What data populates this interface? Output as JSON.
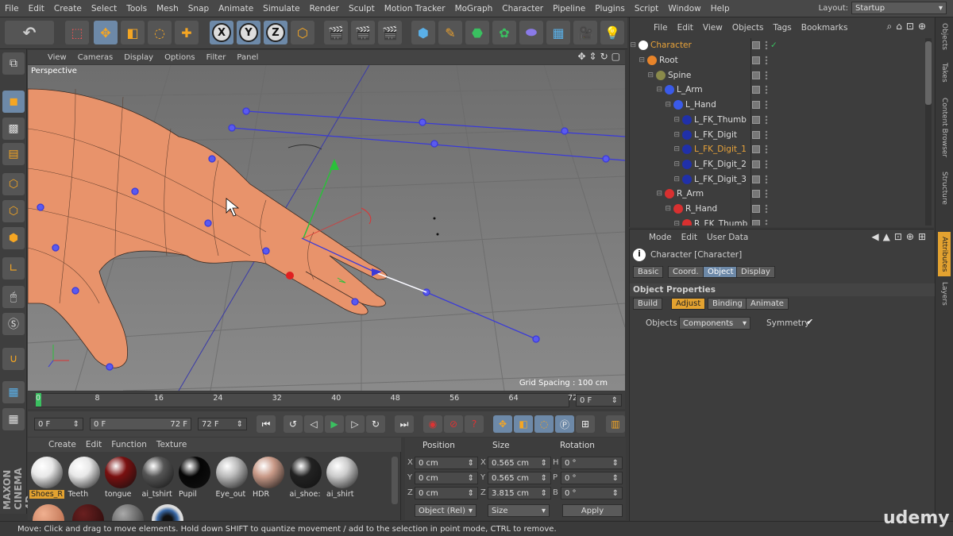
{
  "menubar": {
    "items": [
      "File",
      "Edit",
      "Create",
      "Select",
      "Tools",
      "Mesh",
      "Snap",
      "Animate",
      "Simulate",
      "Render",
      "Sculpt",
      "Motion Tracker",
      "MoGraph",
      "Character",
      "Pipeline",
      "Plugins",
      "Script",
      "Window",
      "Help"
    ],
    "layout_label": "Layout:",
    "layout_value": "Startup"
  },
  "toolbar": {
    "axis_x": "X",
    "axis_y": "Y",
    "axis_z": "Z"
  },
  "viewport": {
    "menu": [
      "View",
      "Cameras",
      "Display",
      "Options",
      "Filter",
      "Panel"
    ],
    "label": "Perspective",
    "grid_spacing": "Grid Spacing : 100 cm"
  },
  "timeline": {
    "ticks": [
      "0",
      "8",
      "16",
      "24",
      "32",
      "40",
      "48",
      "56",
      "64",
      "72"
    ],
    "end_field": "0 F"
  },
  "playback": {
    "start": "0 F",
    "range_start": "0 F",
    "range_end": "72 F",
    "end": "72 F"
  },
  "materials": {
    "menu": [
      "Create",
      "Edit",
      "Function",
      "Texture"
    ],
    "items": [
      {
        "name": "Shoes_R",
        "selected": true,
        "color": "#e8e8e8"
      },
      {
        "name": "Teeth",
        "selected": false,
        "color": "#e8e8e8"
      },
      {
        "name": "tongue",
        "selected": false,
        "color": "#7a1010"
      },
      {
        "name": "ai_tshirt",
        "selected": false,
        "color": "#555555"
      },
      {
        "name": "Pupil",
        "selected": false,
        "color": "#050505"
      },
      {
        "name": "Eye_out",
        "selected": false,
        "color": "#bbbbbb"
      },
      {
        "name": "HDR",
        "selected": false,
        "color": "#c99a88"
      },
      {
        "name": "ai_shoe:",
        "selected": false,
        "color": "#222222"
      },
      {
        "name": "ai_shirt",
        "selected": false,
        "color": "#cccccc"
      }
    ]
  },
  "coords": {
    "position_label": "Position",
    "size_label": "Size",
    "rotation_label": "Rotation",
    "rows": [
      {
        "axis": "X",
        "pos": "0 cm",
        "saxis": "X",
        "size": "0.565 cm",
        "raxis": "H",
        "rot": "0 °"
      },
      {
        "axis": "Y",
        "pos": "0 cm",
        "saxis": "Y",
        "size": "0.565 cm",
        "raxis": "P",
        "rot": "0 °"
      },
      {
        "axis": "Z",
        "pos": "0 cm",
        "saxis": "Z",
        "size": "3.815 cm",
        "raxis": "B",
        "rot": "0 °"
      }
    ],
    "mode_value": "Object (Rel)",
    "size_mode": "Size",
    "apply_label": "Apply"
  },
  "status": "Move: Click and drag to move elements. Hold down SHIFT to quantize movement / add to the selection in point mode, CTRL to remove.",
  "objects": {
    "menu": [
      "File",
      "Edit",
      "View",
      "Objects",
      "Tags",
      "Bookmarks"
    ],
    "tree": [
      {
        "name": "Character",
        "depth": 0,
        "selected": true,
        "icon_color": "#ffffff"
      },
      {
        "name": "Root",
        "depth": 1,
        "selected": false,
        "icon_color": "#e8842a"
      },
      {
        "name": "Spine",
        "depth": 2,
        "selected": false,
        "icon_color": "#8a8a4a"
      },
      {
        "name": "L_Arm",
        "depth": 3,
        "selected": false,
        "icon_color": "#3a5ae8"
      },
      {
        "name": "L_Hand",
        "depth": 4,
        "selected": false,
        "icon_color": "#3a5ae8"
      },
      {
        "name": "L_FK_Thumb",
        "depth": 5,
        "selected": false,
        "icon_color": "#2030a8"
      },
      {
        "name": "L_FK_Digit",
        "depth": 5,
        "selected": false,
        "icon_color": "#2030a8"
      },
      {
        "name": "L_FK_Digit_1",
        "depth": 5,
        "selected": true,
        "icon_color": "#2030a8"
      },
      {
        "name": "L_FK_Digit_2",
        "depth": 5,
        "selected": false,
        "icon_color": "#2030a8"
      },
      {
        "name": "L_FK_Digit_3",
        "depth": 5,
        "selected": false,
        "icon_color": "#2030a8"
      },
      {
        "name": "R_Arm",
        "depth": 3,
        "selected": false,
        "icon_color": "#d83030"
      },
      {
        "name": "R_Hand",
        "depth": 4,
        "selected": false,
        "icon_color": "#d83030"
      },
      {
        "name": "R_FK_Thumb",
        "depth": 5,
        "selected": false,
        "icon_color": "#d83030"
      }
    ]
  },
  "attributes": {
    "menu": [
      "Mode",
      "Edit",
      "User Data"
    ],
    "object_title": "Character [Character]",
    "tabs": [
      "Basic",
      "Coord.",
      "Object",
      "Display"
    ],
    "section": "Object Properties",
    "subtabs": [
      "Build",
      "Adjust",
      "Binding",
      "Animate"
    ],
    "objects_label": "Objects",
    "objects_value": "Components",
    "symmetry_label": "Symmetry",
    "symmetry_check": "✔"
  },
  "right_tabs": [
    "Objects",
    "Takes",
    "Content Browser",
    "Structure",
    "Attributes",
    "Layers"
  ],
  "branding": {
    "maxon": "MAXON",
    "cinema": "CINEMA 4D",
    "udemy": "udemy"
  }
}
